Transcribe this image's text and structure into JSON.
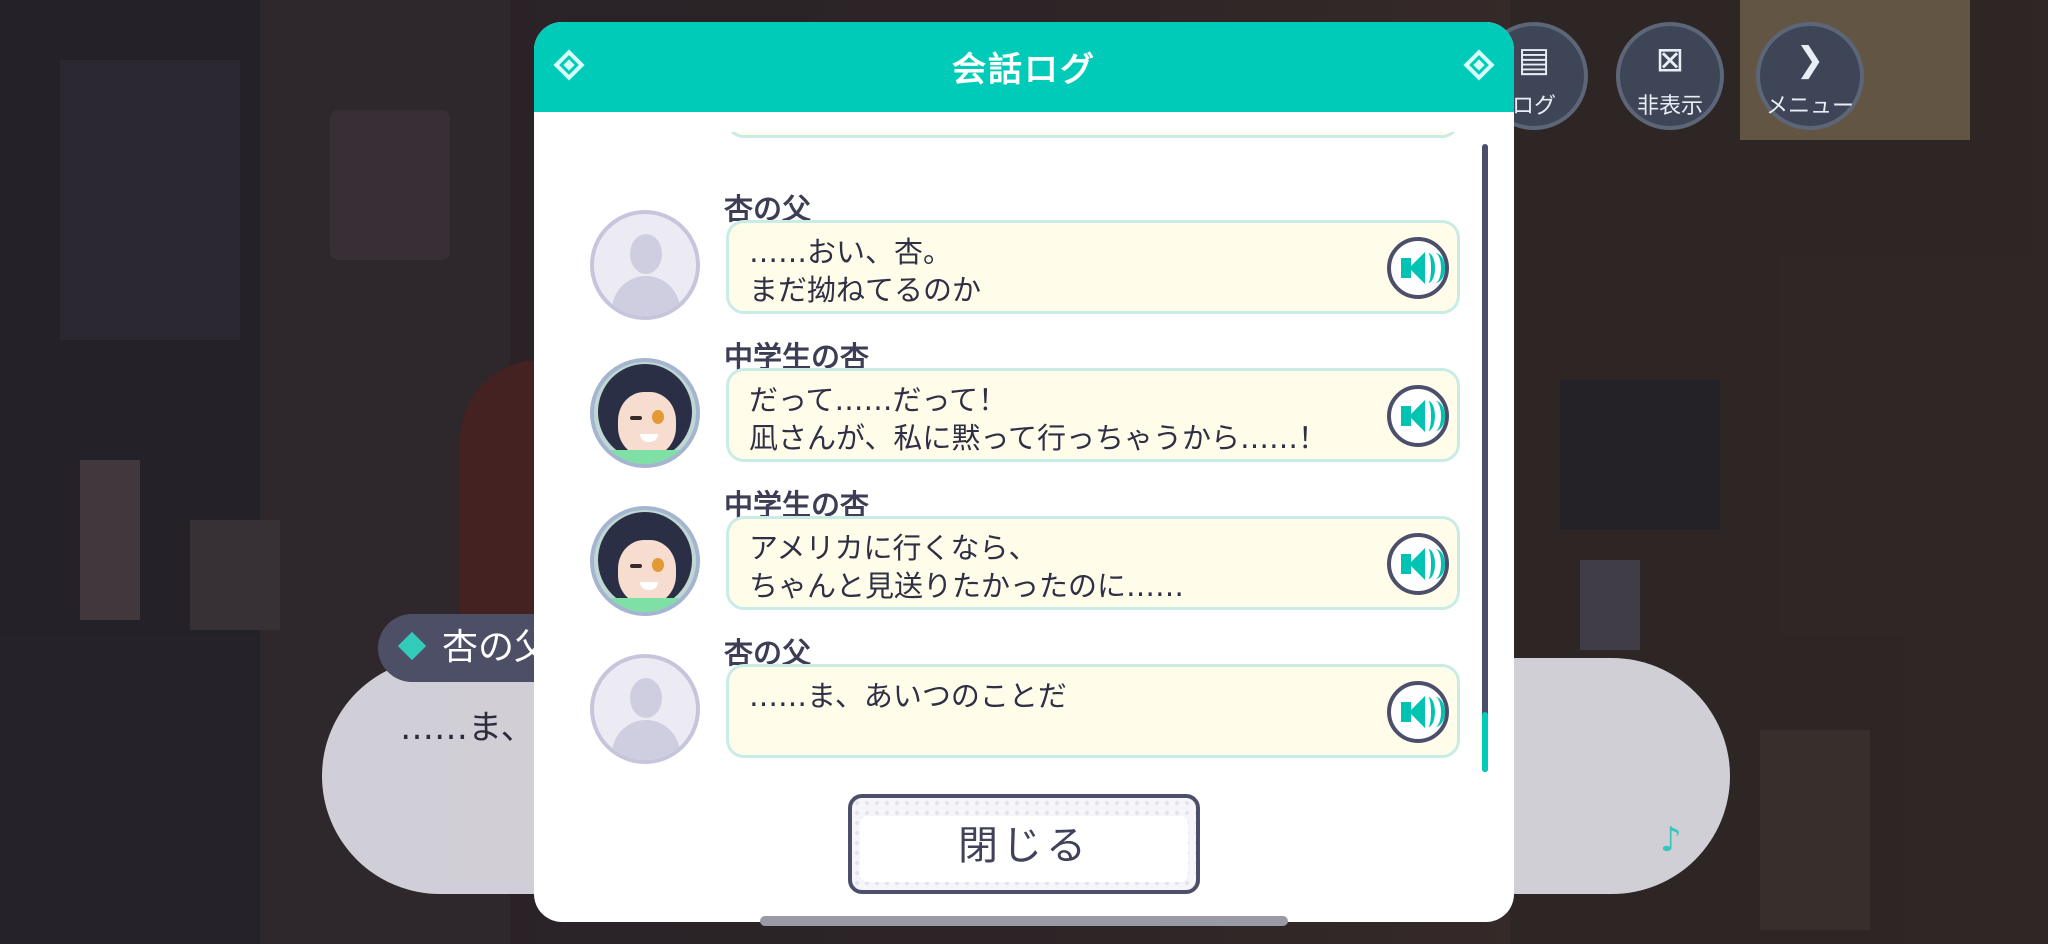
{
  "header_buttons": [
    {
      "label": "ログ",
      "icon": "chat-icon"
    },
    {
      "label": "非表示",
      "icon": "hide-icon"
    },
    {
      "label": "メニュー",
      "icon": "chevron-right-icon"
    }
  ],
  "background_dialog": {
    "speaker": "杏の父",
    "text": "……ま、"
  },
  "modal": {
    "title": "会話ログ",
    "entries": [
      {
        "speaker": "杏の父",
        "text": "……おい、杏。\nまだ拗ねてるのか",
        "avatar": "default-avatar"
      },
      {
        "speaker": "中学生の杏",
        "text": "だって……だって！\n凪さんが、私に黙って行っちゃうから……！",
        "avatar": "girl-avatar"
      },
      {
        "speaker": "中学生の杏",
        "text": "アメリカに行くなら、\nちゃんと見送りたかったのに……",
        "avatar": "girl-avatar"
      },
      {
        "speaker": "杏の父",
        "text": "……ま、あいつのことだ",
        "avatar": "default-avatar"
      }
    ],
    "close_label": "閉じる"
  },
  "colors": {
    "accent": "#00cbb8",
    "bubble": "#fffdea",
    "outline": "#4b4f6a"
  }
}
